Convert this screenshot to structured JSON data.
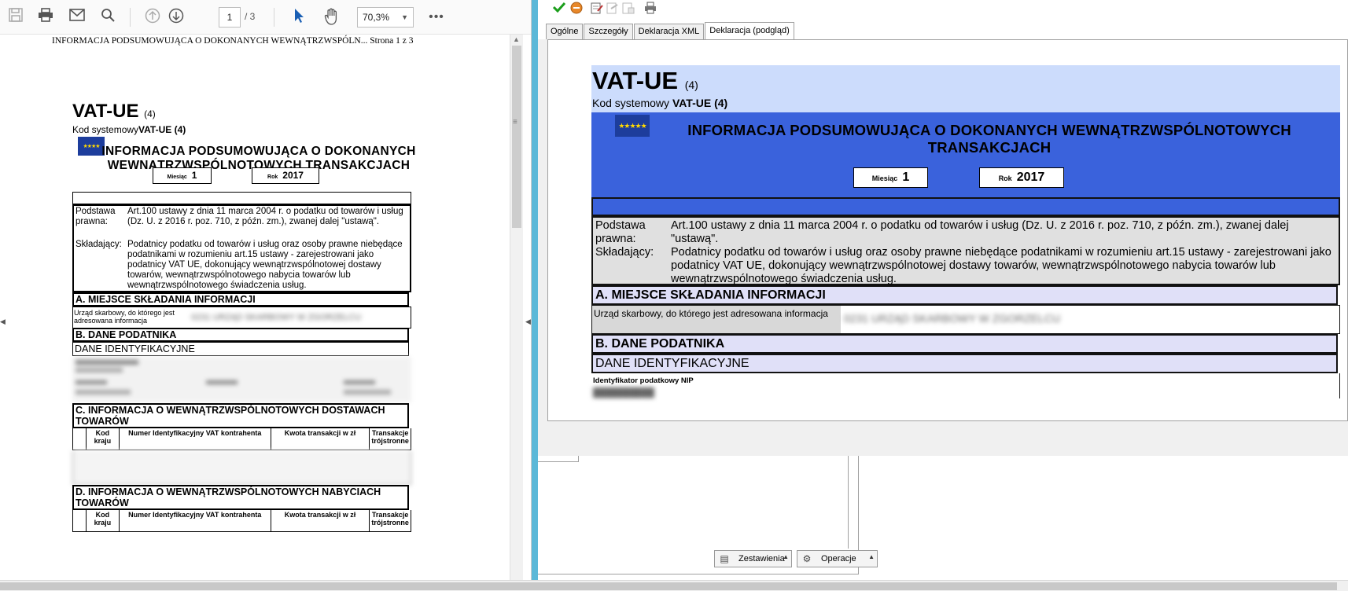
{
  "pdf_viewer": {
    "toolbar": {
      "page_current": "1",
      "page_total": "/ 3",
      "zoom": "70,3%",
      "icons": [
        "save-icon",
        "print-icon",
        "email-icon",
        "search-icon",
        "page-up-icon",
        "page-down-icon",
        "select-cursor-icon",
        "hand-tool-icon",
        "more-icon"
      ]
    },
    "page": {
      "header": "INFORMACJA PODSUMOWUJĄCA O DOKONANYCH WEWNĄTRZWSPÓLN...   Strona 1 z 3",
      "form_code": "VAT-UE",
      "form_variant": "(4)",
      "kod_label": "Kod systemowy",
      "kod_value": "VAT-UE (4)",
      "title": "INFORMACJA PODSUMOWUJĄCA O DOKONANYCH WEWNĄTRZWSPÓLNOTOWYCH TRANSAKCJACH",
      "month_label": "Miesiąc",
      "month_value": "1",
      "year_label": "Rok",
      "year_value": "2017",
      "podstawa_label": "Podstawa prawna:",
      "podstawa_text": "Art.100 ustawy z dnia 11 marca 2004 r. o podatku od towarów i usług (Dz. U. z 2016 r. poz. 710, z późn. zm.), zwanej dalej \"ustawą\".",
      "skladajacy_label": "Składający:",
      "skladajacy_text": "Podatnicy podatku od towarów i usług oraz osoby prawne niebędące podatnikami w rozumieniu art.15 ustawy - zarejestrowani jako podatnicy VAT UE, dokonujący wewnątrzwspólnotowej dostawy towarów, wewnątrzwspólnotowego nabycia towarów lub wewnątrzwspólnotowego świadczenia usług.",
      "section_a": "A. MIEJSCE SKŁADANIA INFORMACJI",
      "urzad_label": "Urząd skarbowy, do którego jest adresowana informacja",
      "urzad_value": "0231 URZĄD SKARBOWY W ZGORZELCU",
      "section_b": "B.  DANE PODATNIKA",
      "dane_ident": "DANE IDENTYFIKACYJNE",
      "section_c": "C. INFORMACJA O WEWNĄTRZWSPÓLNOTOWYCH DOSTAWACH TOWARÓW",
      "section_d": "D. INFORMACJA O WEWNĄTRZWSPÓLNOTOWYCH NABYCIACH TOWARÓW",
      "table_c_headers": [
        "",
        "Kod kraju",
        "Numer Identyfikacyjny VAT kontrahenta",
        "Kwota transakcji w zł",
        "Transakcje trójstronne"
      ],
      "table_d_headers": [
        "",
        "Kod kraju",
        "Numer Identyfikacyjny VAT kontrahenta",
        "Kwota transakcji w zł",
        "Transakcje trójstronne"
      ]
    }
  },
  "app": {
    "toolbar_icons": [
      "accept-icon",
      "cancel-icon",
      "edit-icon",
      "send-icon",
      "upo-icon",
      "print-icon"
    ],
    "tabs": [
      {
        "label": "Ogólne"
      },
      {
        "label": "Szczegóły"
      },
      {
        "label": "Deklaracja XML"
      },
      {
        "label": "Deklaracja (podgląd)"
      }
    ],
    "preview": {
      "form_code": "VAT-UE",
      "form_variant": "(4)",
      "kod_label": "Kod systemowy",
      "kod_value": "VAT-UE (4)",
      "title": "INFORMACJA PODSUMOWUJĄCA O DOKONANYCH WEWNĄTRZWSPÓLNOTOWYCH TRANSAKCJACH",
      "month_label": "Miesiąc",
      "month_value": "1",
      "year_label": "Rok",
      "year_value": "2017",
      "podstawa_label": "Podstawa prawna:",
      "podstawa_text": "Art.100 ustawy z dnia 11 marca 2004 r. o podatku od towarów i usług (Dz. U. z 2016 r. poz. 710, z późn. zm.), zwanej dalej \"ustawą\".",
      "skladajacy_label": "Składający:",
      "skladajacy_text": "Podatnicy podatku od towarów i usług oraz osoby prawne niebędące podatnikami w rozumieniu art.15 ustawy - zarejestrowani jako podatnicy VAT UE, dokonujący wewnątrzwspólnotowej dostawy towarów, wewnątrzwspólnotowego nabycia towarów lub wewnątrzwspólnotowego świadczenia usług.",
      "section_a": "A. MIEJSCE SKŁADANIA INFORMACJI",
      "urzad_label": "Urząd skarbowy, do którego jest adresowana informacja",
      "urzad_value": "0231 URZĄD SKARBOWY W ZGORZELCU",
      "section_b": "B.  DANE PODATNIKA",
      "dane_ident": "DANE IDENTYFIKACYJNE",
      "nip_label": "Identyfikator podatkowy NIP"
    },
    "buttons": {
      "zestawienia": "Zestawienia",
      "operacje": "Operacje"
    }
  },
  "colors": {
    "splitter": "#5bb8d8",
    "preview_head": "#ccdcfc",
    "preview_blue": "#3a62dc",
    "section_bg": "#e0e0f8"
  }
}
